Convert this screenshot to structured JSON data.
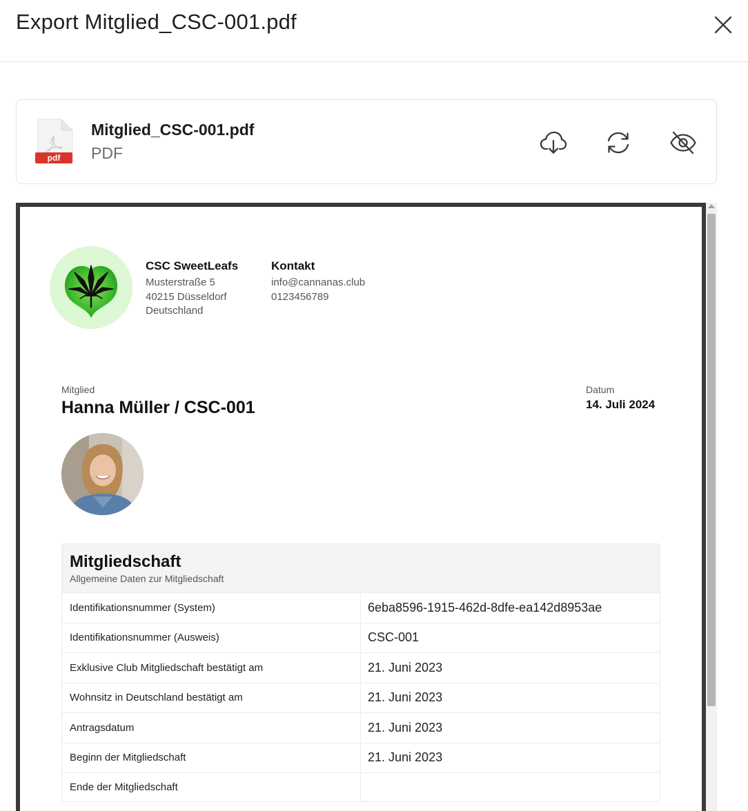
{
  "modal": {
    "title": "Export Mitglied_CSC-001.pdf"
  },
  "file": {
    "name": "Mitglied_CSC-001.pdf",
    "type": "PDF",
    "badge": "pdf"
  },
  "actions": {
    "download_icon": "cloud-download-icon",
    "refresh_icon": "refresh-icon",
    "hide_icon": "eye-off-icon"
  },
  "document": {
    "organization": {
      "name": "CSC SweetLeafs",
      "street": "Musterstraße 5",
      "city": "40215 Düsseldorf",
      "country": "Deutschland"
    },
    "contact": {
      "title": "Kontakt",
      "email": "info@cannanas.club",
      "phone": "0123456789"
    },
    "member_label": "Mitglied",
    "member_name": "Hanna Müller / CSC-001",
    "date_label": "Datum",
    "date_value": "14. Juli 2024",
    "membership": {
      "title": "Mitgliedschaft",
      "subtitle": "Allgemeine Daten zur Mitgliedschaft",
      "rows": [
        {
          "key": "Identifikationsnummer (System)",
          "value": "6eba8596-1915-462d-8dfe-ea142d8953ae"
        },
        {
          "key": "Identifikationsnummer (Ausweis)",
          "value": "CSC-001"
        },
        {
          "key": "Exklusive Club Mitgliedschaft bestätigt am",
          "value": "21. Juni 2023"
        },
        {
          "key": "Wohnsitz in Deutschland bestätigt am",
          "value": "21. Juni 2023"
        },
        {
          "key": "Antragsdatum",
          "value": "21. Juni 2023"
        },
        {
          "key": "Beginn der Mitgliedschaft",
          "value": "21. Juni 2023"
        },
        {
          "key": "Ende der Mitgliedschaft",
          "value": ""
        }
      ]
    }
  },
  "colors": {
    "pdf_badge": "#d9342b",
    "logo_bg": "#dcf8d4",
    "leaf_green": "#3cb82e",
    "frame_border": "#3a3a3a"
  }
}
